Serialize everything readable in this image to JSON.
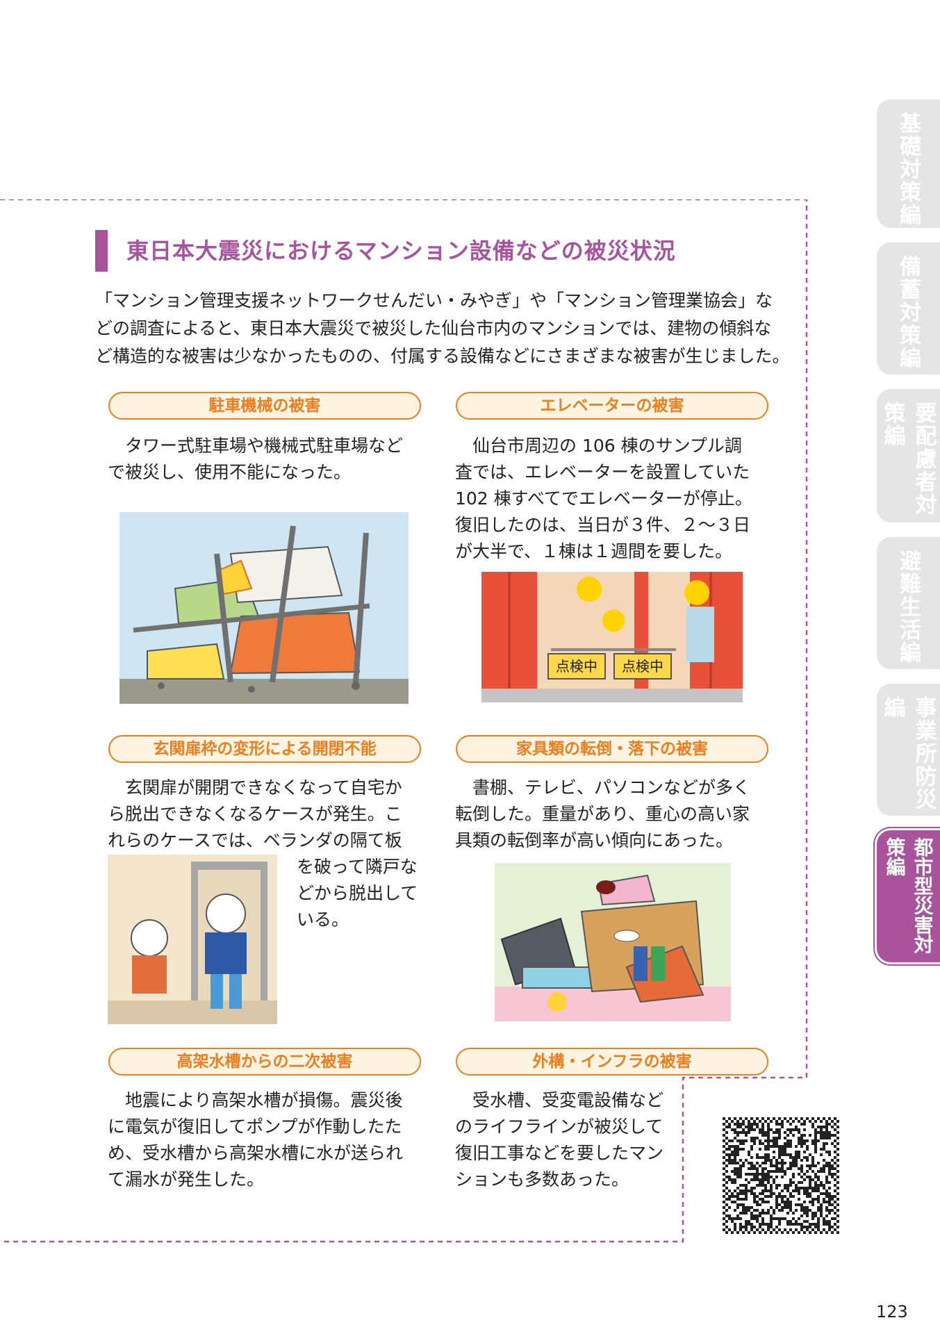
{
  "section": {
    "title": "東日本大震災におけるマンション設備などの被災状況",
    "intro": [
      "「マンション管理支援ネットワークせんだい・みやぎ」や「マンション管理業協会」な",
      "どの調査によると、東日本大震災で被災した仙台市内のマンションでは、建物の傾斜な",
      "ど構造的な被害は少なかったものの、付属する設備などにさまざまな被害が生じました。"
    ]
  },
  "items": [
    {
      "title": "駐車機械の被害",
      "lines": [
        "　タワー式駐車場や機械式駐車場など",
        "で被災し、使用不能になった。"
      ]
    },
    {
      "title": "エレベーターの被害",
      "lines": [
        "　仙台市周辺の 106 棟のサンプル調",
        "査では、エレベーターを設置していた",
        "102 棟すべてでエレベーターが停止。",
        "復旧したのは、当日が３件、２～３日",
        "が大半で、１棟は１週間を要した。"
      ]
    },
    {
      "title": "玄関扉枠の変形による開閉不能",
      "lines": [
        "　玄関扉が開閉できなくなって自宅か",
        "ら脱出できなくなるケースが発生。こ",
        "れらのケースでは、ベランダの隔て板"
      ],
      "lines_side": [
        "を破って隣戸な",
        "どから脱出して",
        "いる。"
      ]
    },
    {
      "title": "家具類の転倒・落下の被害",
      "lines": [
        "　書棚、テレビ、パソコンなどが多く",
        "転倒した。重量があり、重心の高い家",
        "具類の転倒率が高い傾向にあった。"
      ]
    },
    {
      "title": "高架水槽からの二次被害",
      "lines": [
        "　地震により高架水槽が損傷。震災後",
        "に電気が復旧してポンプが作動したた",
        "め、受水槽から高架水槽に水が送られ",
        "て漏水が発生した。"
      ]
    },
    {
      "title": "外構・インフラの被害",
      "lines": [
        "　受水槽、受変電設備など",
        "のライフラインが被災して",
        "復旧工事などを要したマン",
        "ションも多数あった。"
      ]
    }
  ],
  "illustrations": {
    "elevator_signs": [
      "点検中",
      "点検中"
    ]
  },
  "side_tabs": [
    {
      "label": "基礎対策編",
      "active": false
    },
    {
      "label": "備蓄対策編",
      "active": false
    },
    {
      "label": "要配慮者対策編",
      "active": false
    },
    {
      "label": "避難生活編",
      "active": false
    },
    {
      "label": "事業所防災編",
      "active": false
    },
    {
      "label": "都市型災害対策編",
      "active": true
    }
  ],
  "page_number": "123",
  "colors": {
    "accent": "#a8539c",
    "orange": "#ee7d1e",
    "pill_bg": "#fff4e1",
    "tab_inactive": "#e5e5e5"
  }
}
